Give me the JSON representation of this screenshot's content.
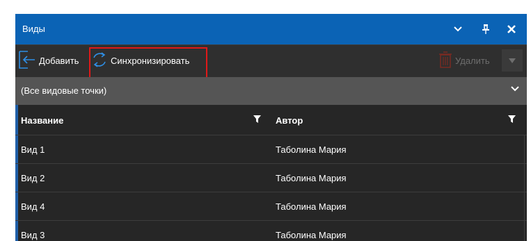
{
  "panel": {
    "title": "Виды",
    "icons": [
      "chevron-down-icon",
      "pin-icon",
      "close-icon"
    ]
  },
  "toolbar": {
    "add_label": "Добавить",
    "sync_label": "Синхронизировать",
    "delete_label": "Удалить"
  },
  "filter": {
    "selected": "(Все видовые точки)"
  },
  "grid": {
    "columns": [
      "Название",
      "Автор"
    ],
    "rows": [
      {
        "name": "Вид 1",
        "author": "Таболина Мария"
      },
      {
        "name": "Вид 2",
        "author": "Таболина Мария"
      },
      {
        "name": "Вид 4",
        "author": "Таболина Мария"
      },
      {
        "name": "Вид 3",
        "author": "Таболина Мария"
      }
    ]
  },
  "colors": {
    "titlebar": "#0b63b5",
    "highlight": "#e01919",
    "accent": "#1f5fa8"
  }
}
